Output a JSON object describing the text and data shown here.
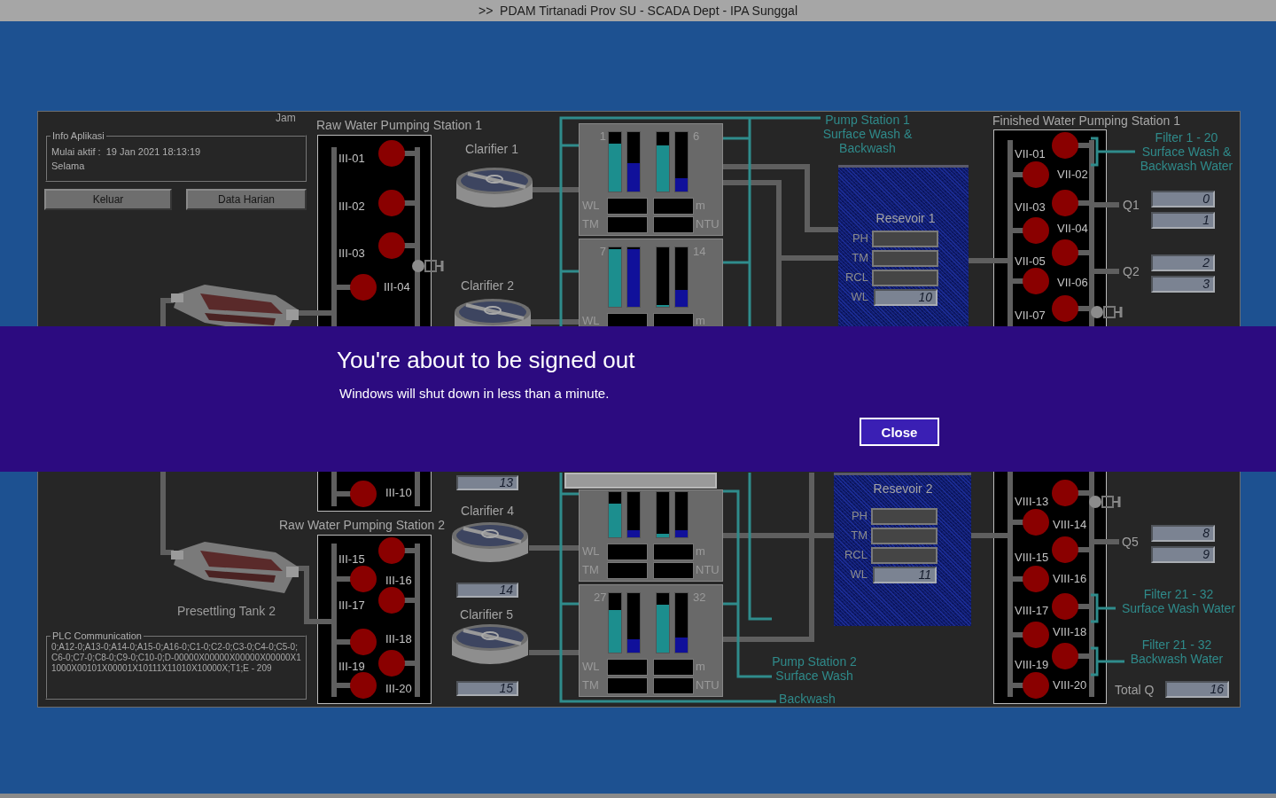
{
  "window": {
    "title": ">>  PDAM Tirtanadi Prov SU - SCADA Dept - IPA Sunggal"
  },
  "clock": {
    "label": "Jam"
  },
  "info_panel": {
    "title": "Info Aplikasi",
    "lines": [
      "Mulai aktif :  19 Jan 2021 18:13:19",
      "Selama"
    ]
  },
  "buttons": [
    "Keluar",
    "Data Harian"
  ],
  "presettling": {
    "label": "Presettling Tank 2"
  },
  "plc_panel": {
    "title": "PLC Communication",
    "text": "0;A12-0;A13-0;A14-0;A15-0;A16-0;C1-0;C2-0;C3-0;C4-0;C5-0;C6-0;C7-0;C8-0;C9-0;C10-0;D-00000X00000X00000X00000X11000X00101X00001X10111X11010X10000X;T1;E - 209"
  },
  "stations": [
    {
      "title": "Raw Water Pumping Station 1",
      "pumps": [
        {
          "label": "III-01",
          "running": false
        },
        {
          "label": "III-02",
          "running": false
        },
        {
          "label": "III-03",
          "running": false
        },
        {
          "label": "III-04",
          "running": false
        },
        {
          "label": "III-10",
          "running": false
        }
      ]
    },
    {
      "title": "Raw Water Pumping Station 2",
      "pumps": [
        {
          "label": "III-15",
          "running": false
        },
        {
          "label": "III-16",
          "running": false
        },
        {
          "label": "III-17",
          "running": false
        },
        {
          "label": "III-18",
          "running": false
        },
        {
          "label": "III-19",
          "running": false
        },
        {
          "label": "III-20",
          "running": false
        }
      ]
    },
    {
      "title": "Finished Water Pumping Station 1",
      "pumps": [
        {
          "label": "VII-01",
          "running": false
        },
        {
          "label": "VII-02",
          "running": false
        },
        {
          "label": "VII-03",
          "running": false
        },
        {
          "label": "VII-04",
          "running": false
        },
        {
          "label": "VII-05",
          "running": false
        },
        {
          "label": "VII-06",
          "running": false
        },
        {
          "label": "VII-07",
          "running": false
        },
        {
          "label": "VIII-13",
          "running": false
        },
        {
          "label": "VIII-14",
          "running": false
        },
        {
          "label": "VIII-15",
          "running": false
        },
        {
          "label": "VIII-16",
          "running": false
        },
        {
          "label": "VIII-17",
          "running": false
        },
        {
          "label": "VIII-18",
          "running": false
        },
        {
          "label": "VIII-19",
          "running": false
        },
        {
          "label": "VIII-20",
          "running": false
        }
      ]
    }
  ],
  "clarifiers": [
    {
      "label": "Clarifier 1"
    },
    {
      "label": "Clarifier 2"
    },
    {
      "label": "Clarifier 4"
    },
    {
      "label": "Clarifier 5"
    }
  ],
  "flow_readings": [
    "13",
    "14",
    "15"
  ],
  "filter_panels": [
    {
      "numbers": [
        "1",
        "6"
      ],
      "left_labels": [
        "WL",
        "TM"
      ],
      "right_labels": [
        "m",
        "NTU"
      ],
      "bars": [
        {
          "level": 0.8
        },
        {
          "level": 0.48
        },
        {
          "level": 0.78
        },
        {
          "level": 0.22
        }
      ]
    },
    {
      "numbers": [
        "7",
        "14"
      ],
      "left_labels": [
        "WL"
      ],
      "right_labels": [
        "m"
      ],
      "bars": [
        {
          "level": 0.97
        },
        {
          "level": 0.97
        },
        {
          "level": 0
        },
        {
          "level": 0.28
        }
      ]
    },
    {
      "left_labels": [
        "WL",
        "TM"
      ],
      "right_labels": [
        "m",
        "NTU"
      ],
      "bars": [
        {
          "level": 0.75
        },
        {
          "level": 0.15
        },
        {
          "level": 0.07
        },
        {
          "level": 0.15
        }
      ]
    },
    {
      "numbers": [
        "27",
        "32"
      ],
      "left_labels": [
        "WL",
        "TM"
      ],
      "right_labels": [
        "m",
        "NTU"
      ],
      "bars": [
        {
          "level": 0.72
        },
        {
          "level": 0.23
        },
        {
          "level": 0.8
        },
        {
          "level": 0.25
        }
      ]
    }
  ],
  "wash_labels": [
    {
      "text": "Pump Station 1\nSurface Wash &\nBackwash"
    },
    {
      "text": "Pump Station 2\nSurface Wash"
    },
    {
      "text": "Backwash"
    },
    {
      "text": "Filter 1 - 20\nSurface Wash &\nBackwash Water"
    },
    {
      "text": "Filter 21 - 32\nSurface Wash Water"
    },
    {
      "text": "Filter 21 - 32\nBackwash Water"
    }
  ],
  "reservoirs": [
    {
      "title": "Resevoir 1",
      "fields": [
        {
          "label": "PH"
        },
        {
          "label": "TM"
        },
        {
          "label": "RCL"
        },
        {
          "label": "WL",
          "value": "10"
        }
      ]
    },
    {
      "title": "Resevoir 2",
      "fields": [
        {
          "label": "PH"
        },
        {
          "label": "TM"
        },
        {
          "label": "RCL"
        },
        {
          "label": "WL",
          "value": "11"
        }
      ]
    }
  ],
  "flow_meters": [
    {
      "label": "Q1",
      "values": [
        "0",
        "1"
      ]
    },
    {
      "label": "Q2",
      "values": [
        "2",
        "3"
      ]
    },
    {
      "label": "Q5",
      "values": [
        "8",
        "9"
      ]
    }
  ],
  "total": {
    "label": "Total Q",
    "value": "16"
  },
  "dialog": {
    "title": "You're about to be signed out",
    "message": "Windows will shut down in less than a minute.",
    "button": "Close"
  }
}
